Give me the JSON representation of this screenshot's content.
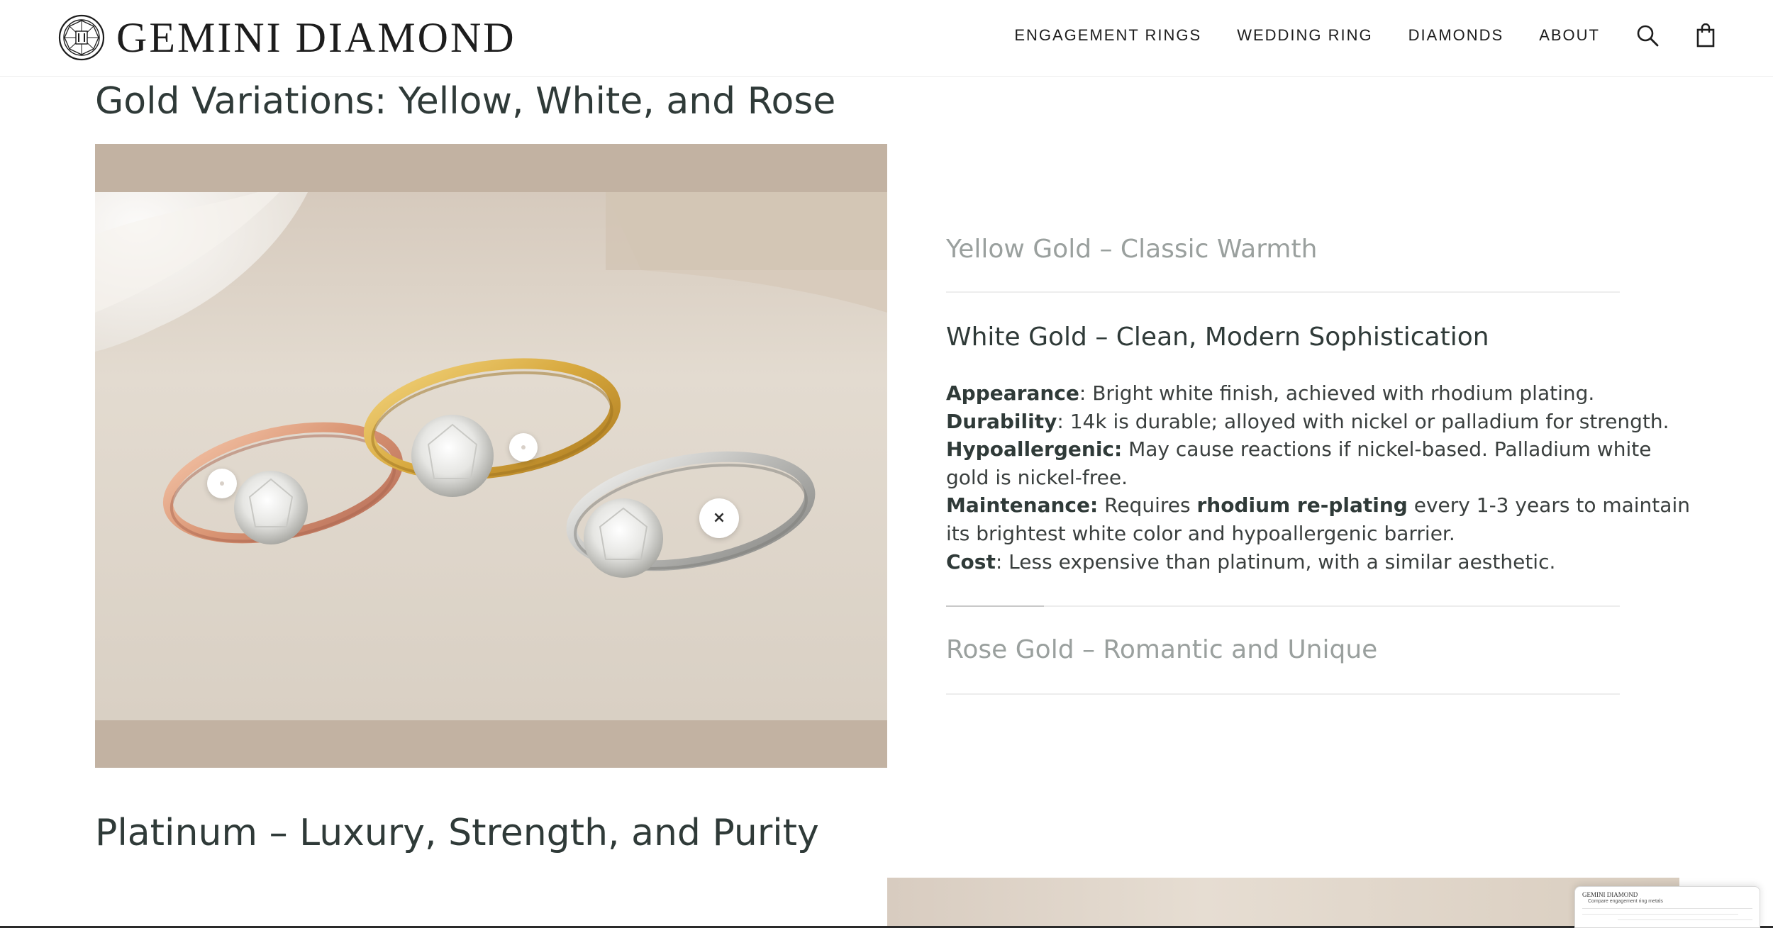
{
  "header": {
    "brand": "GEMINI DIAMOND",
    "logo_icon": "diamond-emblem",
    "nav": [
      {
        "label": "ENGAGEMENT RINGS"
      },
      {
        "label": "WEDDING RING"
      },
      {
        "label": "DIAMONDS"
      },
      {
        "label": "ABOUT"
      }
    ],
    "search_icon": "search-icon",
    "cart_icon": "shopping-bag-icon"
  },
  "gold_section": {
    "title": "Gold Variations: Yellow, White, and Rose",
    "image": {
      "subject": "three solitaire engagement rings in rose, yellow and white gold",
      "hotspots": [
        {
          "label": "",
          "state": "inactive"
        },
        {
          "label": "",
          "state": "inactive"
        },
        {
          "label": "×",
          "state": "active"
        }
      ]
    },
    "accordion": [
      {
        "title": "Yellow Gold – Classic Warmth",
        "open": false
      },
      {
        "title": "White Gold – Clean, Modern Sophistication",
        "open": true,
        "details": [
          {
            "label": "Appearance",
            "text": ": Bright white finish, achieved with rhodium plating."
          },
          {
            "label": "Durability",
            "text": ": 14k is durable; alloyed with nickel or palladium for strength."
          },
          {
            "label": "Hypoallergenic:",
            "text": " May cause reactions if nickel-based. Palladium white",
            "continuation": "gold is nickel-free."
          },
          {
            "label": "Maintenance:",
            "text_before": " Requires ",
            "emphasis": "rhodium re-plating",
            "text": " every 1-3 years to maintain",
            "continuation": "its brightest white color and hypoallergenic barrier."
          },
          {
            "label": "Cost",
            "text": ": Less expensive than platinum, with a similar aesthetic."
          }
        ],
        "progress": 0.145
      },
      {
        "title": "Rose Gold – Romantic and Unique",
        "open": false
      }
    ]
  },
  "platinum_section": {
    "title": "Platinum – Luxury, Strength, and Purity"
  },
  "floating_preview": {
    "brand": "GEMINI DIAMOND",
    "caption": "Compare engagement ring metals"
  },
  "colors": {
    "heading": "#2f3a38",
    "muted_heading": "#9aa09e",
    "image_backdrop": "#c2b2a2"
  }
}
